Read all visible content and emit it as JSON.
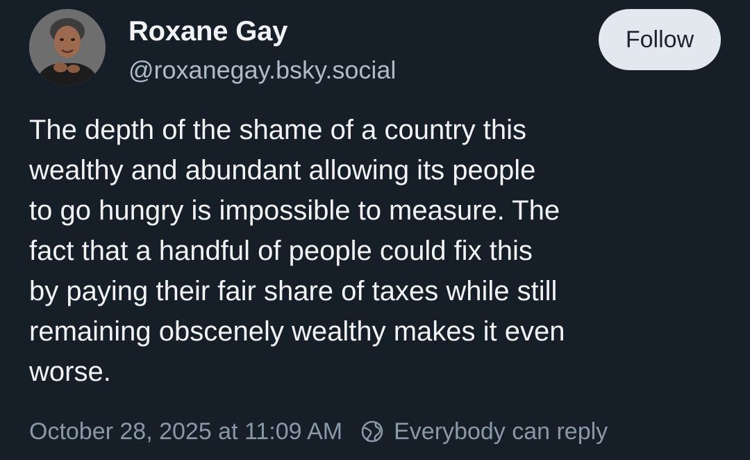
{
  "author": {
    "display_name": "Roxane Gay",
    "handle": "@roxanegay.bsky.social"
  },
  "follow_button": {
    "label": "Follow"
  },
  "post": {
    "text": "The depth of the shame of a country this\nwealthy and abundant allowing its people\nto go hungry is impossible to measure. The\nfact that a handful of people could fix this\nby paying their fair share of taxes while still\nremaining obscenely wealthy makes it even\nworse.",
    "timestamp": "October 28, 2025 at 11:09 AM",
    "reply_setting": "Everybody can reply",
    "reply_icon": "globe-icon"
  },
  "colors": {
    "background": "#161e27",
    "text": "#f1f3f5",
    "muted": "#8b98a8",
    "handle": "#aebbc9",
    "button_bg": "#e3e8ef",
    "button_text": "#1a2330"
  }
}
